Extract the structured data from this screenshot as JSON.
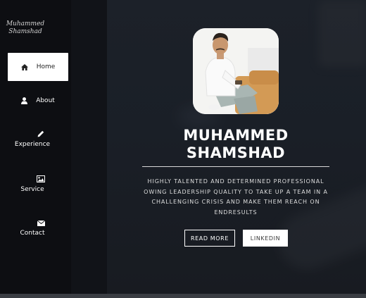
{
  "brand": {
    "line1": "Muhammed",
    "line2": "Shamshad"
  },
  "nav": {
    "items": [
      {
        "label": "Home",
        "icon": "home-icon",
        "active": true
      },
      {
        "label": "About",
        "icon": "user-icon",
        "active": false
      },
      {
        "label": "Experience",
        "icon": "pencil-icon",
        "active": false
      },
      {
        "label": "Service",
        "icon": "image-icon",
        "active": false
      },
      {
        "label": "Contact",
        "icon": "envelope-icon",
        "active": false
      }
    ]
  },
  "hero": {
    "name_line1": "MUHAMMED",
    "name_line2": "SHAMSHAD",
    "tagline_lines": [
      "HIGHLY TALENTED AND DETERMINED PROFESSIONAL",
      "OWING LEADERSHIP QUALITY TO TAKE UP A TEAM IN A",
      "CHALLENGING CRISIS AND MAKE THEM REACH ON",
      "ENDRESULTS"
    ],
    "read_more_label": "READ MORE",
    "linkedin_label": "LINKEDIN"
  },
  "colors": {
    "sidebar_bg": "#0d0e12",
    "hero_bg": "#1c2129",
    "active_nav_bg": "#ffffff",
    "text": "#ffffff"
  }
}
